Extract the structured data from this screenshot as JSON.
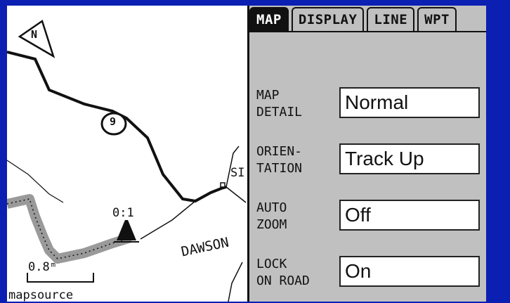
{
  "map": {
    "road_number": "9",
    "waypoint_label": "0:1",
    "street_label": "DAWSON",
    "town_label": "SI",
    "scale": "0.8ᵐ",
    "credit": "mapsource"
  },
  "settings": {
    "tabs": [
      {
        "label": "MAP",
        "active": true
      },
      {
        "label": "DISPLAY",
        "active": false
      },
      {
        "label": "LINE",
        "active": false
      },
      {
        "label": "WPT",
        "active": false
      }
    ],
    "rows": [
      {
        "label": "MAP\nDETAIL",
        "value": "Normal"
      },
      {
        "label": "ORIEN-\nTATION",
        "value": "Track Up"
      },
      {
        "label": "AUTO\nZOOM",
        "value": "Off"
      },
      {
        "label": "LOCK\nON ROAD",
        "value": "On"
      }
    ]
  },
  "colors": {
    "frame": "#0b1fb3",
    "panel": "#c0c0c0",
    "track": "#9a9a9a"
  }
}
